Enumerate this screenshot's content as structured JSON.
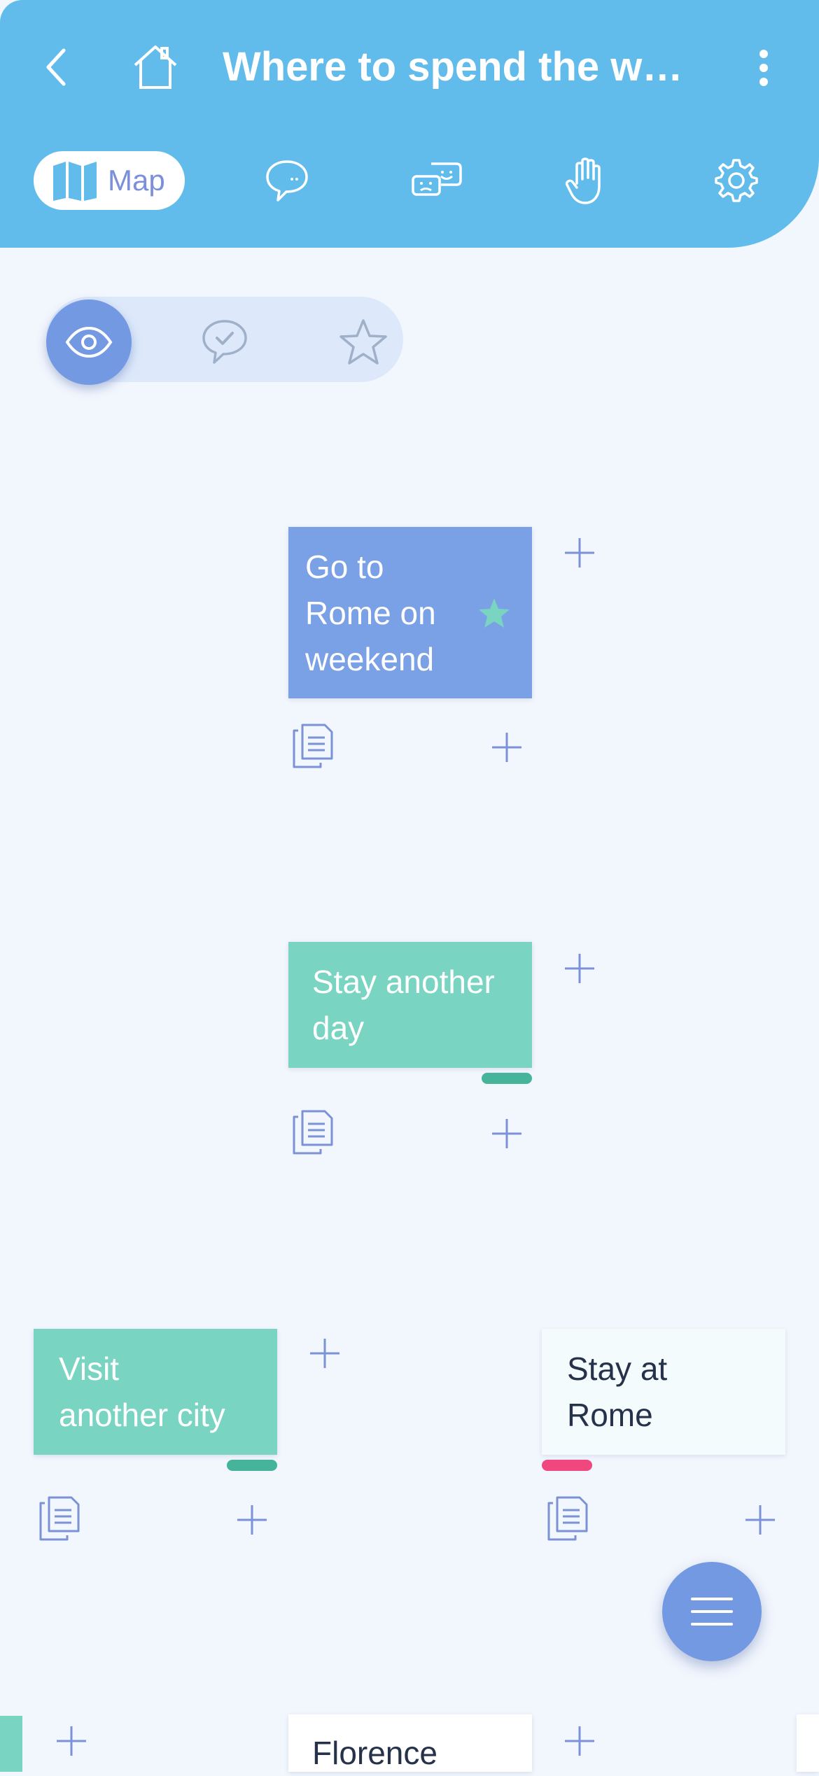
{
  "header": {
    "title": "Where to spend the weekend",
    "back_icon": "chevron-left-icon",
    "home_icon": "house-icon",
    "more_icon": "vertical-dots-icon",
    "bg_color": "#62bceb"
  },
  "tabs": [
    {
      "label": "Map",
      "icon": "map-icon",
      "active": true
    },
    {
      "label": "",
      "icon": "chat-bubble-icon"
    },
    {
      "label": "",
      "icon": "emotions-chat-icon"
    },
    {
      "label": "",
      "icon": "hand-icon"
    },
    {
      "label": "",
      "icon": "gear-icon"
    }
  ],
  "view_toggle": {
    "options": [
      "eye-icon",
      "check-bubble-icon",
      "star-icon"
    ],
    "selected": "eye-icon"
  },
  "nodes": {
    "root": {
      "text": "Go to\nRome on\nweekend",
      "starred": true,
      "color": "#7aa0e6"
    },
    "stay_another_day": {
      "text": "Stay another\nday",
      "color": "#7ad4c2",
      "indicator": "#46b39b"
    },
    "visit_another_city": {
      "text": "Visit\nanother city",
      "color": "#7ad4c2",
      "indicator": "#46b39b"
    },
    "stay_at_rome": {
      "text": "Stay at\nRome",
      "color": "#f4fbfd",
      "indicator": "#f0477f"
    },
    "florence": {
      "text": "Florence"
    }
  },
  "fab": {
    "icon": "menu-lines-icon"
  }
}
